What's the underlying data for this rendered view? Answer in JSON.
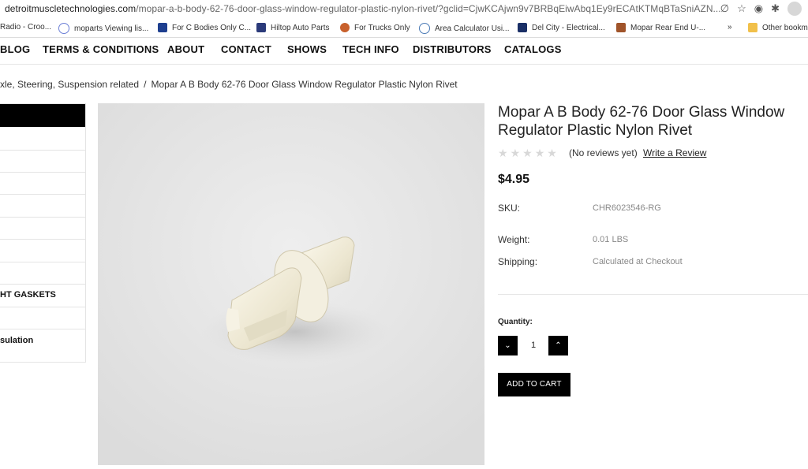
{
  "browser": {
    "url_domain": "detroitmuscletechnologies.com",
    "url_path": "/mopar-a-b-body-62-76-door-glass-window-regulator-plastic-nylon-rivet/?gclid=CjwKCAjwn9v7BRBqEiwAbq1Ey9rECAtKTMqBTaSniAZN..."
  },
  "bookmarks": [
    {
      "label": "Radio - Croo..."
    },
    {
      "label": "moparts Viewing lis..."
    },
    {
      "label": "For C Bodies Only C..."
    },
    {
      "label": "Hiltop Auto Parts"
    },
    {
      "label": "For Trucks Only"
    },
    {
      "label": "Area Calculator Usi..."
    },
    {
      "label": "Del City - Electrical..."
    },
    {
      "label": "Mopar Rear End U-..."
    },
    {
      "label": "»"
    },
    {
      "label": "Other bookm"
    }
  ],
  "nav": [
    "BLOG",
    "TERMS & CONDITIONS",
    "ABOUT",
    "CONTACT",
    "SHOWS",
    "TECH INFO",
    "DISTRIBUTORS",
    "CATALOGS"
  ],
  "breadcrumb": {
    "parent": "xle, Steering, Suspension related",
    "separator": "/",
    "current": "Mopar A B Body 62-76 Door Glass Window Regulator Plastic Nylon Rivet"
  },
  "sidebar": {
    "items": [
      "",
      "",
      "",
      "",
      "",
      "",
      "HT GASKETS",
      "",
      "sulation"
    ]
  },
  "product": {
    "title": "Mopar A B Body 62-76 Door Glass Window Regulator Plastic Nylon Rivet",
    "reviews_text": "(No reviews yet)",
    "write_review": "Write a Review",
    "price": "$4.95",
    "sku_label": "SKU:",
    "sku_value": "CHR6023546-RG",
    "weight_label": "Weight:",
    "weight_value": "0.01 LBS",
    "shipping_label": "Shipping:",
    "shipping_value": "Calculated at Checkout",
    "quantity_label": "Quantity:",
    "quantity_value": "1",
    "add_to_cart": "ADD TO CART",
    "rating": 0,
    "star_color": "#d8d8d8"
  }
}
